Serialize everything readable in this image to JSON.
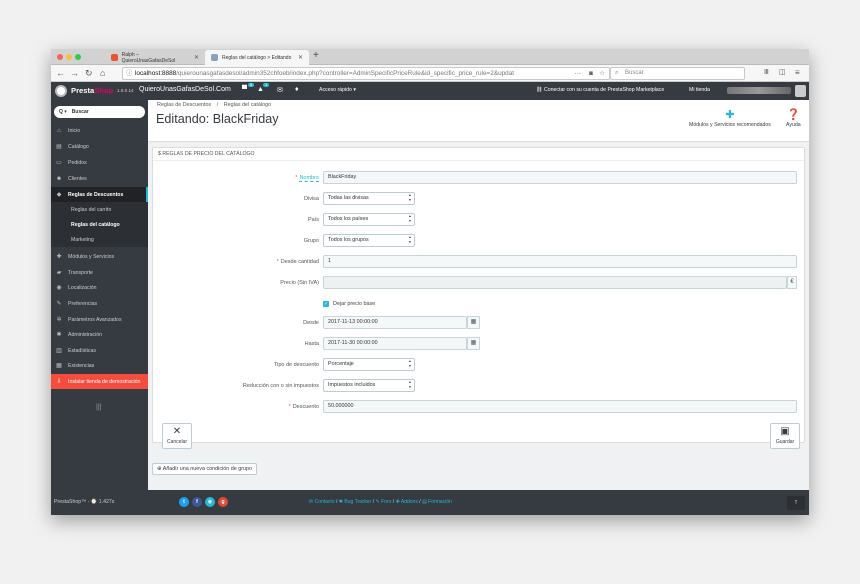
{
  "browser": {
    "tabs": [
      {
        "label": "Ralph – QuieroUnasGafasDeSol"
      },
      {
        "label": "Reglas del catálogo > Editando"
      }
    ],
    "url_host": "localhost:8888",
    "url_path": "/quierounasgafasdesol/admin352chfoeb/index.php?controller=AdminSpecificPriceRule&id_specific_price_rule=2&updat",
    "search_placeholder": "Buscar",
    "url_menu": "···"
  },
  "header": {
    "brand_presta": "Presta",
    "brand_shop": "Shop",
    "version": "1.6.0.14",
    "shop_name": "QuieroUnasGafasDeSol.Com",
    "badge_cart": "5",
    "badge_users": "1",
    "quick_access": "Acceso rápido ▾",
    "marketplace": "Conectar con su cuenta de PrestaShop Marketplace",
    "my_store": "Mi tienda"
  },
  "sidebar": {
    "search_prefix": "Q ▾",
    "search_placeholder": "Buscar",
    "items": [
      {
        "label": "Inicio",
        "icon": "home-icon",
        "glyph": "⌂"
      },
      {
        "label": "Catálogo",
        "icon": "book-icon",
        "glyph": "▤"
      },
      {
        "label": "Pedidos",
        "icon": "credit-card-icon",
        "glyph": "▭"
      },
      {
        "label": "Clientes",
        "icon": "users-icon",
        "glyph": "☻"
      },
      {
        "label": "Reglas de Descuentos",
        "icon": "tag-icon",
        "glyph": "◆"
      },
      {
        "label": "Reglas del carrito"
      },
      {
        "label": "Reglas del catálogo"
      },
      {
        "label": "Marketing"
      },
      {
        "label": "Módulos y Servicios",
        "icon": "puzzle-icon",
        "glyph": "✚"
      },
      {
        "label": "Transporte",
        "icon": "truck-icon",
        "glyph": "▰"
      },
      {
        "label": "Localización",
        "icon": "globe-icon",
        "glyph": "◉"
      },
      {
        "label": "Preferencias",
        "icon": "wrench-icon",
        "glyph": "✎"
      },
      {
        "label": "Parámetros Avanzados",
        "icon": "cogs-icon",
        "glyph": "✲"
      },
      {
        "label": "Administración",
        "icon": "cog-icon",
        "glyph": "✱"
      },
      {
        "label": "Estadísticas",
        "icon": "bar-chart-icon",
        "glyph": "▥"
      },
      {
        "label": "Existencias",
        "icon": "archive-icon",
        "glyph": "▦"
      },
      {
        "label": "Instalar tienda de demostración",
        "icon": "download-icon",
        "glyph": "⇩"
      }
    ],
    "collapse_glyph": "|||"
  },
  "page": {
    "breadcrumb_parent": "Reglas de Descuentos",
    "breadcrumb_sep": "/",
    "breadcrumb_current": "Reglas del catálogo",
    "title": "Editando: BlackFriday",
    "btn_modules": "Módulos y Servicios recomendados",
    "btn_help": "Ayuda"
  },
  "panel": {
    "heading": "$ REGLAS DE PRECIO DEL CATÁLOGO",
    "required_mark": "*",
    "fields": {
      "name_label": "Nombre",
      "name_value": "BlackFriday",
      "currency_label": "Divisa",
      "currency_value": "Todas las divisas",
      "country_label": "País",
      "country_value": "Todos los países",
      "group_label": "Grupo",
      "group_value": "Todos los grupos",
      "from_qty_label": "Desde cantidad",
      "from_qty_value": "1",
      "price_label": "Precio (Sin IVA)",
      "price_value": "",
      "currency_symbol": "€",
      "keep_price_label": "Dejar precio base",
      "from_label": "Desde",
      "from_value": "2017-11-13 00:00:00",
      "to_label": "Hasta",
      "to_value": "2017-11-30 00:00:00",
      "discount_type_label": "Tipo de descuento",
      "discount_type_value": "Porcentaje",
      "tax_label": "Reducción con o sin impuestos",
      "tax_value": "Impuestos incluidos",
      "discount_label": "Descuento",
      "discount_value": "50.000000"
    },
    "cancel_label": "Cancelar",
    "save_label": "Guardar"
  },
  "add_condition_label": "Añadir una nueva condición de grupo",
  "footer": {
    "left": "PrestaShop™ - ⌚ 1.427s",
    "contact": "Contacto",
    "bug": "Bug Tracker",
    "forum": "Foro",
    "addons": "Addons",
    "training": "Formación",
    "sep": "/"
  },
  "colors": {
    "accent": "#25b9d7",
    "sidebar": "#363a41",
    "demo": "#f54c3e",
    "brand_pink": "#df0067"
  }
}
